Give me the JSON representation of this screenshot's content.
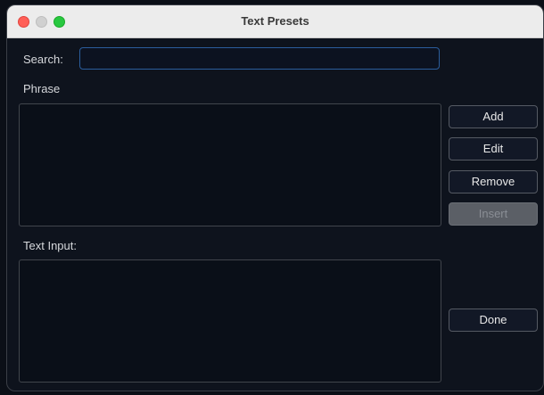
{
  "window": {
    "title": "Text Presets"
  },
  "search": {
    "label": "Search:",
    "value": "",
    "placeholder": ""
  },
  "phrase": {
    "label": "Phrase"
  },
  "buttons": {
    "add": "Add",
    "edit": "Edit",
    "remove": "Remove",
    "insert": "Insert",
    "done": "Done"
  },
  "text_input": {
    "label": "Text Input:"
  },
  "colors": {
    "background": "#0e131d",
    "titlebar": "#ececec",
    "search_focus_border": "#2b5d9c",
    "close": "#ff5f57",
    "zoom": "#28c840"
  }
}
